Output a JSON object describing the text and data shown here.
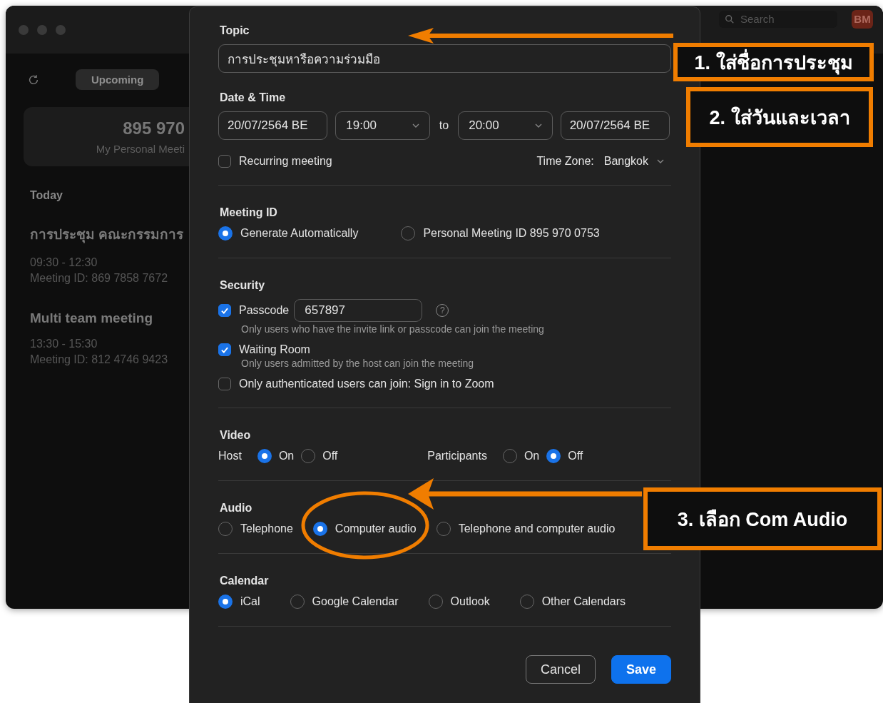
{
  "main_window": {
    "search": {
      "placeholder": "Search"
    },
    "avatar": "BM",
    "tabs": [
      {
        "label": "Upcoming",
        "selected": true
      }
    ],
    "personal_meeting": {
      "id": "895 970",
      "label": "My Personal Meeti"
    },
    "section": "Today",
    "meetings": [
      {
        "title": "การประชุม คณะกรรมการ",
        "time": "09:30 - 12:30",
        "meeting_id": "Meeting ID: 869 7858 7672"
      },
      {
        "title": "Multi team meeting",
        "time": "13:30 - 15:30",
        "meeting_id": "Meeting ID: 812 4746 9423"
      }
    ]
  },
  "dialog": {
    "topic": {
      "label": "Topic",
      "value": "การประชุมหารือความร่วมมือ"
    },
    "date_time": {
      "label": "Date & Time",
      "start_date": "20/07/2564 BE",
      "start_time": "19:00",
      "to": "to",
      "end_time": "20:00",
      "end_date": "20/07/2564 BE",
      "recurring": {
        "label": "Recurring meeting",
        "checked": false
      },
      "time_zone_label": "Time Zone:",
      "time_zone": "Bangkok"
    },
    "meeting_id": {
      "label": "Meeting ID",
      "options": [
        {
          "label": "Generate Automatically",
          "selected": true
        },
        {
          "label": "Personal Meeting ID 895 970 0753",
          "selected": false
        }
      ]
    },
    "security": {
      "label": "Security",
      "items": [
        {
          "label": "Passcode",
          "checked": true,
          "value": "657897",
          "help": "?",
          "hint": "Only users who have the invite link or passcode can join the meeting"
        },
        {
          "label": "Waiting Room",
          "checked": true,
          "hint": "Only users admitted by the host can join the meeting"
        },
        {
          "label": "Only authenticated users can join: Sign in to Zoom",
          "checked": false
        }
      ]
    },
    "video": {
      "label": "Video",
      "groups": [
        {
          "label": "Host",
          "options": [
            {
              "label": "On",
              "selected": true
            },
            {
              "label": "Off",
              "selected": false
            }
          ]
        },
        {
          "label": "Participants",
          "options": [
            {
              "label": "On",
              "selected": false
            },
            {
              "label": "Off",
              "selected": true
            }
          ]
        }
      ]
    },
    "audio": {
      "label": "Audio",
      "options": [
        {
          "label": "Telephone",
          "selected": false
        },
        {
          "label": "Computer audio",
          "selected": true
        },
        {
          "label": "Telephone and computer audio",
          "selected": false
        }
      ]
    },
    "calendar": {
      "label": "Calendar",
      "options": [
        {
          "label": "iCal",
          "selected": true
        },
        {
          "label": "Google Calendar",
          "selected": false
        },
        {
          "label": "Outlook",
          "selected": false
        },
        {
          "label": "Other Calendars",
          "selected": false
        }
      ]
    },
    "buttons": [
      {
        "label": "Cancel",
        "kind": "secondary"
      },
      {
        "label": "Save",
        "kind": "primary"
      }
    ]
  },
  "annotations": [
    {
      "text": "1. ใส่ชื่อการประชุม"
    },
    {
      "text": "2. ใส่วันและเวลา"
    },
    {
      "text": "3. เลือก Com Audio"
    }
  ]
}
